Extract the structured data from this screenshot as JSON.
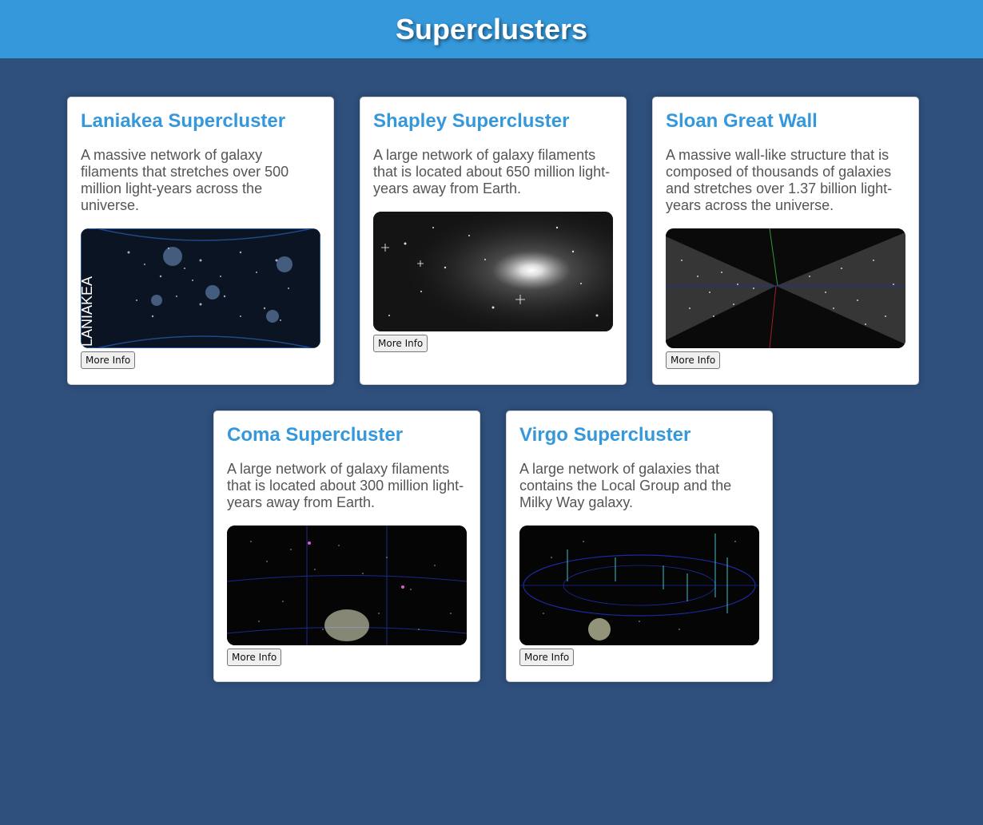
{
  "header": {
    "title": "Superclusters"
  },
  "cards": [
    {
      "title": "Laniakea Supercluster",
      "description": "A massive network of galaxy filaments that stretches over 500 million light-years across the universe.",
      "button_label": "More Info",
      "image_text": "LANIAKEA"
    },
    {
      "title": "Shapley Supercluster",
      "description": "A large network of galaxy filaments that is located about 650 million light-years away from Earth.",
      "button_label": "More Info"
    },
    {
      "title": "Sloan Great Wall",
      "description": "A massive wall-like structure that is composed of thousands of galaxies and stretches over 1.37 billion light-years across the universe.",
      "button_label": "More Info"
    },
    {
      "title": "Coma Supercluster",
      "description": "A large network of galaxy filaments that is located about 300 million light-years away from Earth.",
      "button_label": "More Info"
    },
    {
      "title": "Virgo Supercluster",
      "description": "A large network of galaxies that contains the Local Group and the Milky Way galaxy.",
      "button_label": "More Info"
    }
  ],
  "colors": {
    "header_bg": "#3498db",
    "page_bg": "#2f4f7c",
    "card_title": "#3498db",
    "card_text": "#555555"
  }
}
